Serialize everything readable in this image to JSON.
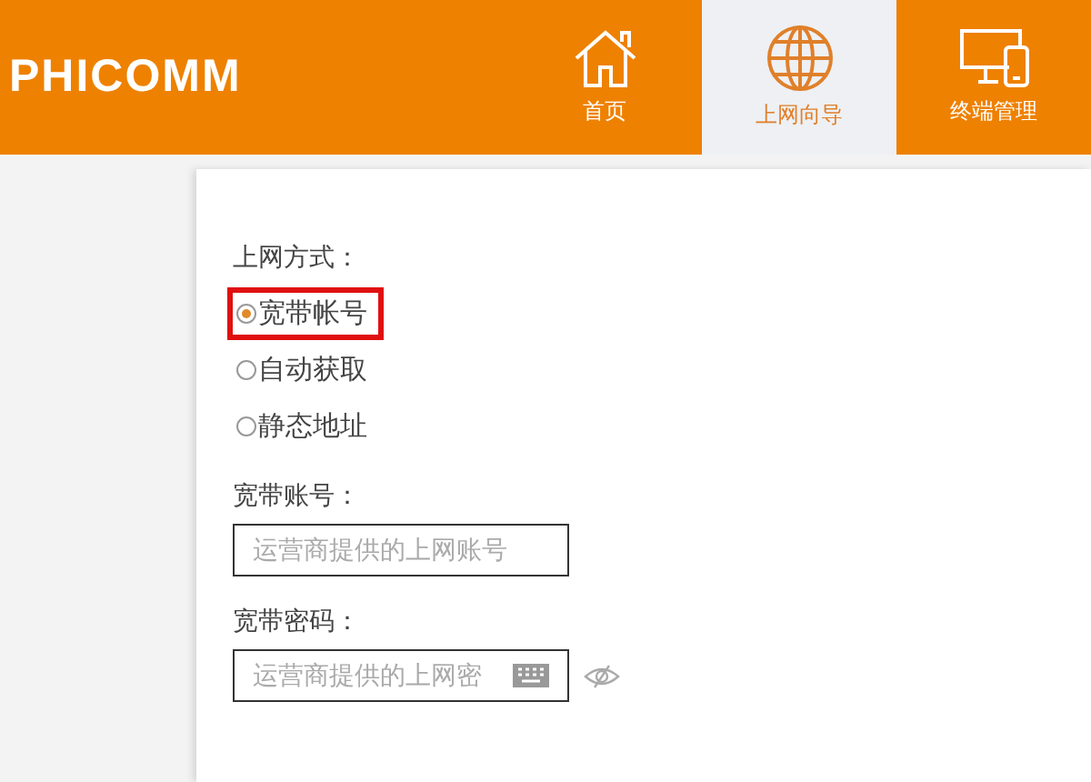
{
  "header": {
    "logo": "PHICOMM",
    "nav": [
      {
        "label": "首页",
        "selected": false
      },
      {
        "label": "上网向导",
        "selected": true
      },
      {
        "label": "终端管理",
        "selected": false
      }
    ]
  },
  "form": {
    "mode_label": "上网方式：",
    "modes": [
      {
        "label": "宽带帐号",
        "selected": true
      },
      {
        "label": "自动获取",
        "selected": false
      },
      {
        "label": "静态地址",
        "selected": false
      }
    ],
    "account_label": "宽带账号：",
    "account_placeholder": "运营商提供的上网账号",
    "password_label": "宽带密码：",
    "password_placeholder": "运营商提供的上网密"
  }
}
